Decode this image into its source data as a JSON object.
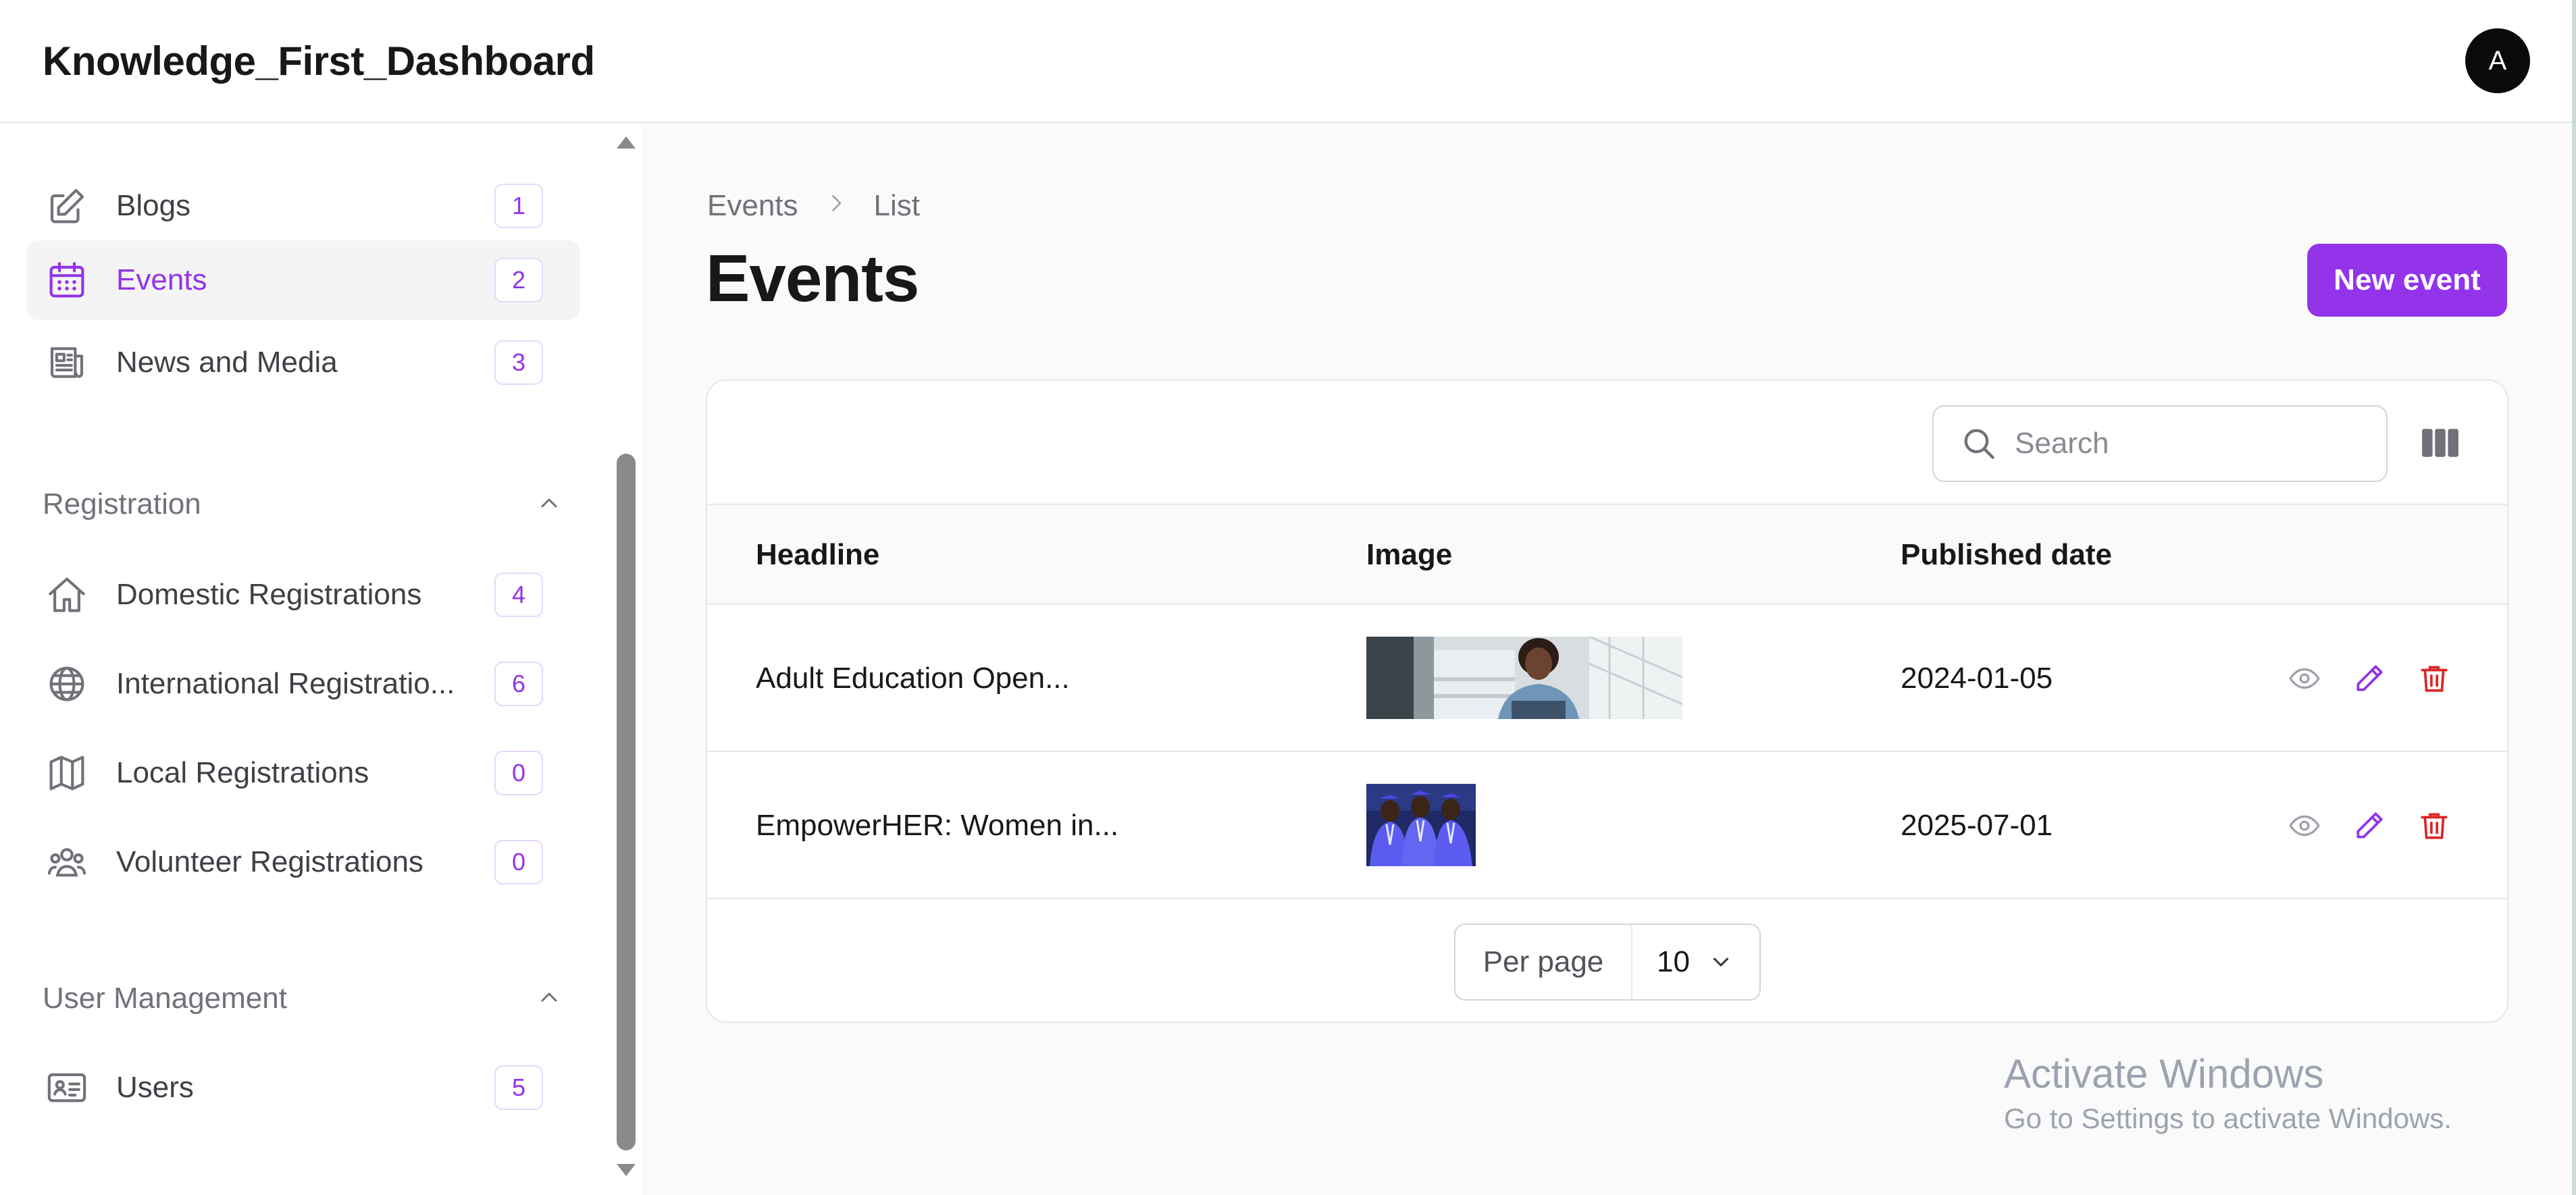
{
  "app": {
    "title": "Knowledge_First_Dashboard",
    "avatar_initial": "A"
  },
  "sidebar": {
    "items": [
      {
        "label": "Blogs",
        "count": "1",
        "icon": "pencil-square-icon",
        "active": false
      },
      {
        "label": "Events",
        "count": "2",
        "icon": "calendar-icon",
        "active": true
      },
      {
        "label": "News and Media",
        "count": "3",
        "icon": "newspaper-icon",
        "active": false
      }
    ],
    "groups": [
      {
        "label": "Registration",
        "items": [
          {
            "label": "Domestic Registrations",
            "count": "4",
            "icon": "home-icon"
          },
          {
            "label": "International Registratio...",
            "count": "6",
            "icon": "globe-icon"
          },
          {
            "label": "Local Registrations",
            "count": "0",
            "icon": "map-icon"
          },
          {
            "label": "Volunteer Registrations",
            "count": "0",
            "icon": "user-group-icon"
          }
        ]
      },
      {
        "label": "User Management",
        "items": [
          {
            "label": "Users",
            "count": "5",
            "icon": "id-card-icon"
          }
        ]
      }
    ]
  },
  "breadcrumb": {
    "items": [
      "Events",
      "List"
    ]
  },
  "page": {
    "title": "Events",
    "new_button": "New event"
  },
  "table": {
    "search_placeholder": "Search",
    "columns": [
      "Headline",
      "Image",
      "Published date"
    ],
    "rows": [
      {
        "headline": "Adult Education Open...",
        "image": "photo-woman-with-laptop",
        "published": "2024-01-05"
      },
      {
        "headline": "EmpowerHER: Women in...",
        "image": "photo-graduates-in-gowns",
        "published": "2025-07-01"
      }
    ],
    "per_page_label": "Per page",
    "per_page_value": "10"
  },
  "watermark": {
    "title": "Activate Windows",
    "subtitle": "Go to Settings to activate Windows."
  },
  "colors": {
    "accent": "#9333ea",
    "danger": "#dc2626",
    "muted": "#71717a"
  }
}
